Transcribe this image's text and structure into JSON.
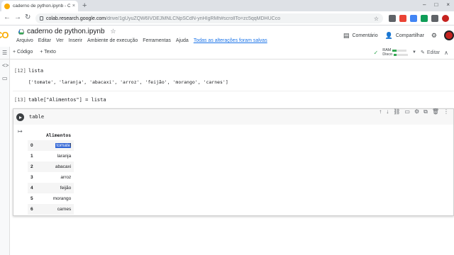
{
  "browser": {
    "tab_title": "caderno de python.ipynb - Cola",
    "tab_close": "×",
    "new_tab": "+",
    "win_minimize": "–",
    "win_maximize": "□",
    "win_close": "×",
    "url_host": "colab.research.google.com",
    "url_path": "/drive/1gUyuZQW6IVDEJMNLCNpSCdN-ynHIgRMh#scrollTo=zc5qqMDHUCco"
  },
  "colab": {
    "logo": "CO",
    "doc_title": "caderno de python.ipynb",
    "menu": [
      "Arquivo",
      "Editar",
      "Ver",
      "Inserir",
      "Ambiente de execução",
      "Ferramentas",
      "Ajuda"
    ],
    "saved_status": "Todas as alterações foram salvas",
    "comment_label": "Comentário",
    "share_label": "Compartilhar"
  },
  "toolbar": {
    "code_label": "+ Código",
    "text_label": "+ Texto",
    "ram_label": "RAM",
    "disk_label": "Disco",
    "ram_fraction": 0.3,
    "disk_fraction": 0.2,
    "edit_label": "Editar"
  },
  "cells": [
    {
      "count": "[12]",
      "code": "lista",
      "output": "['tomate', 'laranja', 'abacaxi', 'arroz', 'feijão', 'morango', 'carnes']"
    },
    {
      "count": "[13]",
      "code": "table[\"Alimentos\"] = lista"
    },
    {
      "count": "",
      "code": "table"
    }
  ],
  "dataframe": {
    "column": "Alimentos",
    "rows": [
      {
        "index": "0",
        "value": "tomate"
      },
      {
        "index": "1",
        "value": "laranja"
      },
      {
        "index": "2",
        "value": "abacaxi"
      },
      {
        "index": "3",
        "value": "arroz"
      },
      {
        "index": "4",
        "value": "feijão"
      },
      {
        "index": "5",
        "value": "morango"
      },
      {
        "index": "6",
        "value": "carnes"
      }
    ]
  },
  "colors": {
    "accent": "#f9ab00",
    "link": "#1a73e8",
    "selection": "#3367d6",
    "avatar": "#c5221f"
  }
}
